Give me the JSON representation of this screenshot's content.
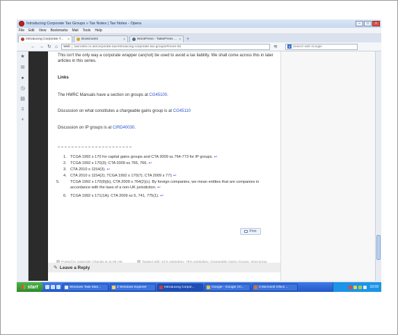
{
  "window": {
    "title": "Introducing Corporate Tax Groups » Tax Notes | Tax Notes - Opera"
  },
  "menu": [
    "File",
    "Edit",
    "View",
    "Bookmarks",
    "Mail",
    "Tools",
    "Help"
  ],
  "tabs": [
    {
      "label": "Introducing Corporate T...",
      "active": true
    },
    {
      "label": "Bookmarks",
      "active": false
    },
    {
      "label": "WordPress › TablePress ...",
      "active": false
    }
  ],
  "nav": {
    "web_label": "Web",
    "url": "taxnotes.co.uk/corporate-tax/introducing-corporate-tax-groups/#more-82",
    "search_placeholder": "Search with Google"
  },
  "article": {
    "intro": "This isn't the only way a corporate wrapper can(not) be used to avoid a tax liability. We shall come across this in later articles in this series.",
    "links_heading": "Links",
    "link1_text": "The HMRC Manuals have a section on groups at ",
    "link1_anchor": "CG45100",
    "link1_end": ".",
    "link2_text": "Discussion on what constitutes a chargeable gains group is at ",
    "link2_anchor": "CG45110",
    "link3_text": "Discussion on IP groups is at ",
    "link3_anchor": "CIRD40030",
    "link3_end": "."
  },
  "footnotes": [
    {
      "num": "1.",
      "text": "TCGA 1992 s 170 for capital gains groups and CTA 2009 ss 764-773 for IP groups.",
      "back": "↩"
    },
    {
      "num": "2.",
      "text": "TCGA 1992 s 170(3); CTA 2009 ss 765, 766.",
      "back": "↩"
    },
    {
      "num": "3.",
      "text": "CTA 2010 s 1154(3).",
      "back": "↩"
    },
    {
      "num": "4.",
      "text": "CTA 2010 s 1154(2); TCGA 1992 s 170(7); CTA 2009 s 771",
      "back": "↩"
    },
    {
      "num": "5.",
      "text": "TCGA 1992 s 170(9)(b), CTA 2009 s 764(2)(c). By foreign companies, we mean entities that are companies in accordance with the laws of a non-UK jurisdiction.",
      "back": "↩"
    },
    {
      "num": "6.",
      "text": "TCGA 1992 s 171(1A); CTA 2009 ss 5, 741, 775(1).",
      "back": "↩"
    }
  ],
  "print_label": "Print",
  "post_meta": {
    "posted_by": "Posted by Satvinder Chanda at 11:06 AM",
    "tagged": "Tagged with: 51% subsidiary, 75% subsidiary, Chargeable Gains Groups, Intra-group transfers, IP Groups"
  },
  "leave_reply": "Leave a Reply",
  "taskbar": {
    "start_label": "start",
    "tasks": [
      {
        "label": "Windows Task Man...",
        "active": false
      },
      {
        "label": "2 Windows Explorer",
        "active": false
      },
      {
        "label": "Introducing Corpor...",
        "active": true
      },
      {
        "label": "Google - Google Ch...",
        "active": false
      },
      {
        "label": "3 Microsoft Office ...",
        "active": false
      }
    ],
    "time": "10:09"
  }
}
